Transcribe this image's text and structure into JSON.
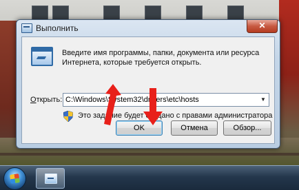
{
  "window": {
    "title": "Выполнить",
    "close_glyph": "✕"
  },
  "dialog": {
    "description": "Введите имя программы, папки, документа или ресурса Интернета, которые требуется открыть.",
    "open_label_accel": "О",
    "open_label_rest": "ткрыть:",
    "command_value": "C:\\Windows\\System32\\drivers\\etc\\hosts",
    "admin_note": "Это задание будет создано с правами администратора",
    "dropdown_glyph": "▼"
  },
  "buttons": {
    "ok": "OK",
    "cancel": "Отмена",
    "browse": "Обзор..."
  },
  "colors": {
    "arrow_red": "#e8201a",
    "titlebar_glass": "#c5d6e8",
    "close_red": "#c75a42"
  },
  "icons": {
    "app": "run-dialog-icon",
    "shield": "uac-shield-icon",
    "start": "windows-start-orb",
    "taskbar_item": "run-dialog-icon"
  }
}
